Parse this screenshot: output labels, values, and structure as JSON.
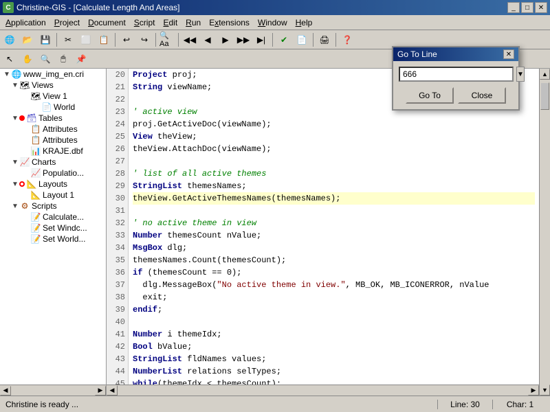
{
  "window": {
    "title": "Christine-GIS - [Calculate Length And Areas]",
    "icon_label": "C"
  },
  "menubar": {
    "items": [
      "Application",
      "Project",
      "Document",
      "Script",
      "Edit",
      "Run",
      "Extensions",
      "Window",
      "Help"
    ]
  },
  "toolbar1": {
    "buttons": [
      "🌐",
      "📂",
      "💾",
      "✂️",
      "📋",
      "📄",
      "↩",
      "↪",
      "🔍",
      "Aa",
      "◁",
      "◁◁",
      "▷▷",
      "▷",
      "✔️",
      "📄",
      "🖨",
      "❓"
    ]
  },
  "toolbar2": {
    "buttons": [
      "↖",
      "✋",
      "🔍",
      "🖱",
      "📌"
    ]
  },
  "tree": {
    "items": [
      {
        "id": "root",
        "label": "www_img_en.cri",
        "level": 0,
        "icon": "globe",
        "toggle": "▼"
      },
      {
        "id": "views",
        "label": "Views",
        "level": 1,
        "icon": "folder",
        "toggle": "▼"
      },
      {
        "id": "view1",
        "label": "View 1",
        "level": 2,
        "icon": "doc",
        "toggle": ""
      },
      {
        "id": "world",
        "label": "World",
        "level": 3,
        "icon": "doc",
        "toggle": ""
      },
      {
        "id": "tables",
        "label": "Tables",
        "level": 1,
        "icon": "table",
        "toggle": "▼",
        "dot": "red"
      },
      {
        "id": "attr1",
        "label": "Attributes",
        "level": 2,
        "icon": "doc",
        "toggle": ""
      },
      {
        "id": "attr2",
        "label": "Attributes",
        "level": 2,
        "icon": "doc",
        "toggle": ""
      },
      {
        "id": "kraje",
        "label": "KRAJE.dbf",
        "level": 2,
        "icon": "dbf",
        "toggle": ""
      },
      {
        "id": "charts",
        "label": "Charts",
        "level": 1,
        "icon": "chart",
        "toggle": "▼"
      },
      {
        "id": "pop",
        "label": "Populatio...",
        "level": 2,
        "icon": "doc",
        "toggle": ""
      },
      {
        "id": "layouts",
        "label": "Layouts",
        "level": 1,
        "icon": "layout",
        "toggle": "▼",
        "dot": "outline"
      },
      {
        "id": "layout1",
        "label": "Layout 1",
        "level": 2,
        "icon": "doc",
        "toggle": ""
      },
      {
        "id": "scripts",
        "label": "Scripts",
        "level": 1,
        "icon": "script",
        "toggle": "▼"
      },
      {
        "id": "calc",
        "label": "Calculate...",
        "level": 2,
        "icon": "calc",
        "toggle": ""
      },
      {
        "id": "setwindc",
        "label": "Set Windc...",
        "level": 2,
        "icon": "calc",
        "toggle": ""
      },
      {
        "id": "setworld",
        "label": "Set World...",
        "level": 2,
        "icon": "calc",
        "toggle": ""
      }
    ]
  },
  "code": {
    "lines": [
      {
        "num": 20,
        "text": "  Project proj;",
        "classes": [
          "kw-proj"
        ]
      },
      {
        "num": 21,
        "text": "  String viewName;",
        "classes": []
      },
      {
        "num": 22,
        "text": "",
        "classes": []
      },
      {
        "num": 23,
        "text": "  ' active view",
        "classes": [
          "comment"
        ]
      },
      {
        "num": 24,
        "text": "  proj.GetActiveDoc(viewName);",
        "classes": []
      },
      {
        "num": 25,
        "text": "  View theView;",
        "classes": []
      },
      {
        "num": 26,
        "text": "  theView.AttachDoc(viewName);",
        "classes": []
      },
      {
        "num": 27,
        "text": "",
        "classes": []
      },
      {
        "num": 28,
        "text": "  ' list of all active themes",
        "classes": [
          "comment"
        ]
      },
      {
        "num": 29,
        "text": "  StringList themesNames;",
        "classes": []
      },
      {
        "num": 30,
        "text": "  theView.GetActiveThemesNames(themesNames);",
        "classes": [
          "highlighted"
        ]
      },
      {
        "num": 31,
        "text": "",
        "classes": []
      },
      {
        "num": 32,
        "text": "  ' no active theme in view",
        "classes": [
          "comment"
        ]
      },
      {
        "num": 33,
        "text": "  Number themesCount nValue;",
        "classes": []
      },
      {
        "num": 34,
        "text": "  MsgBox dlg;",
        "classes": []
      },
      {
        "num": 35,
        "text": "  themesNames.Count(themesCount);",
        "classes": []
      },
      {
        "num": 36,
        "text": "  if (themesCount == 0);",
        "classes": []
      },
      {
        "num": 37,
        "text": "    dlg.MessageBox(\"No active theme in view.\", MB_OK, MB_ICONERROR, nValue",
        "classes": []
      },
      {
        "num": 38,
        "text": "    exit;",
        "classes": []
      },
      {
        "num": 39,
        "text": "  endif;",
        "classes": []
      },
      {
        "num": 40,
        "text": "",
        "classes": []
      },
      {
        "num": 41,
        "text": "  Number i themeIdx;",
        "classes": []
      },
      {
        "num": 42,
        "text": "  Bool bValue;",
        "classes": []
      },
      {
        "num": 43,
        "text": "  StringList fldNames values;",
        "classes": []
      },
      {
        "num": 44,
        "text": "  NumberList relations selTypes;",
        "classes": []
      },
      {
        "num": 45,
        "text": "  while(themeIdx < themesCount);",
        "classes": []
      }
    ]
  },
  "dialog": {
    "title": "Go To Line",
    "input_value": "666",
    "goto_label": "Go To",
    "close_label": "Close"
  },
  "statusbar": {
    "ready": "Christine is ready ...",
    "line": "Line: 30",
    "char": "Char: 1"
  }
}
